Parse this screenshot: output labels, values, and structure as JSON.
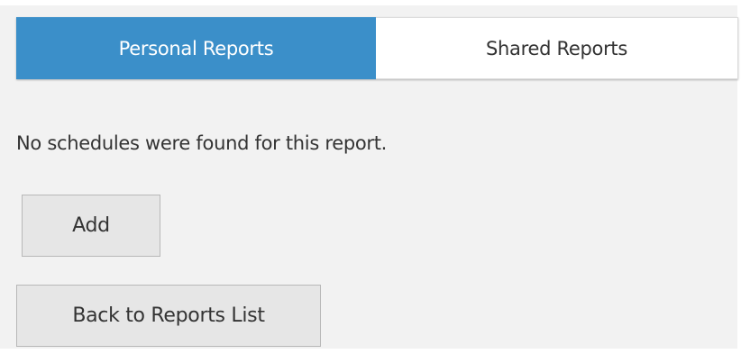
{
  "tabs": {
    "personal_label": "Personal Reports",
    "shared_label": "Shared Reports",
    "active_color": "#3b8fc9"
  },
  "content": {
    "message": "No schedules were found for this report."
  },
  "actions": {
    "add_label": "Add",
    "back_label": "Back to Reports List"
  }
}
